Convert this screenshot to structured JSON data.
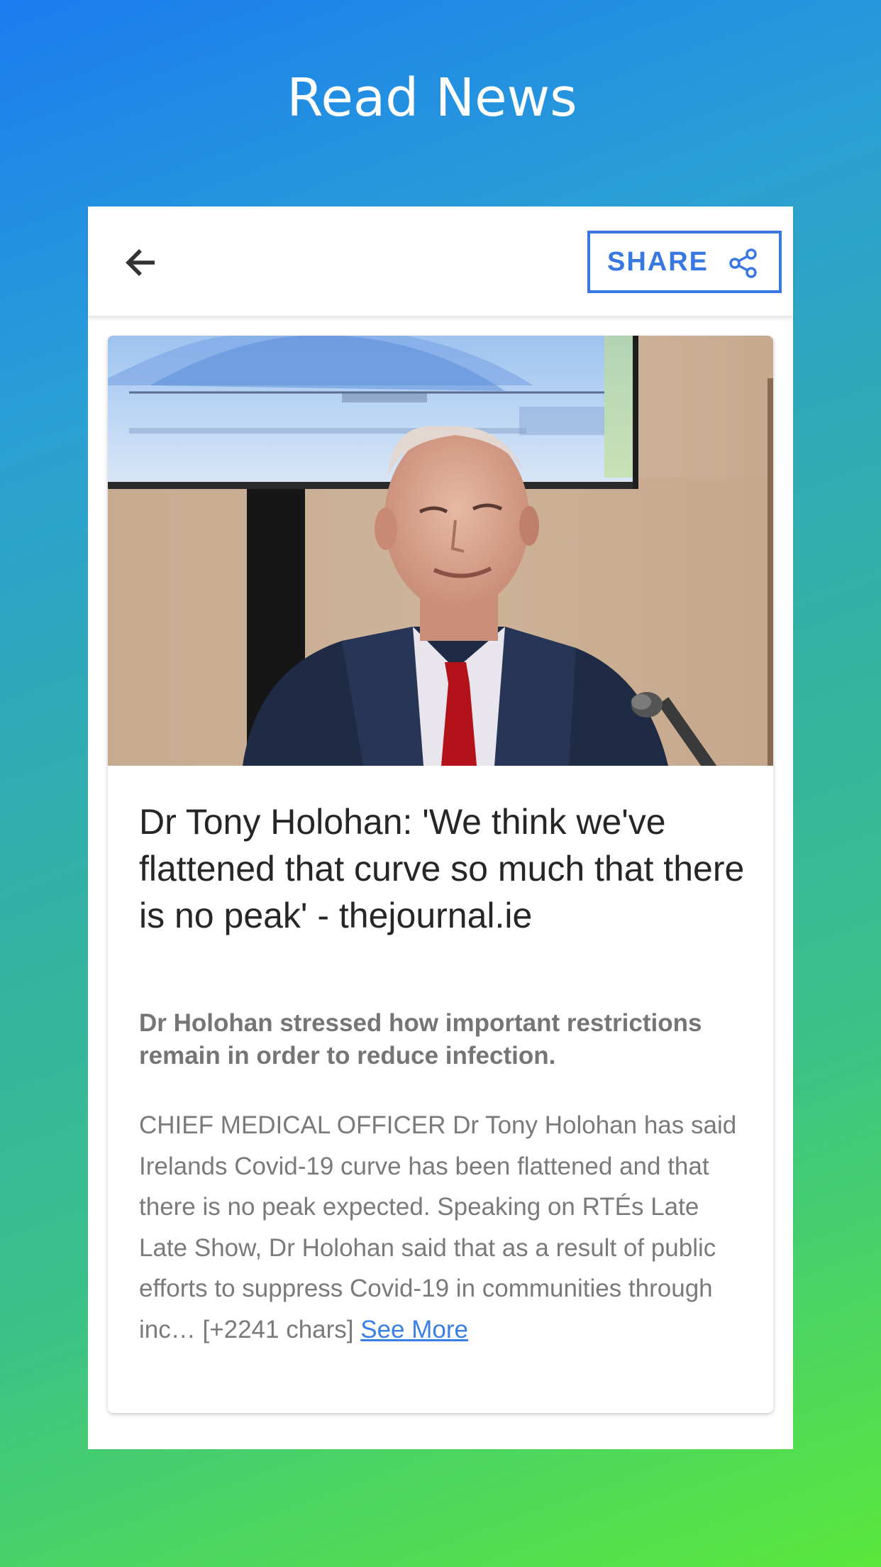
{
  "app": {
    "title": "Read News"
  },
  "toolbar": {
    "back_icon": "arrow-left-icon",
    "share_label": "SHARE",
    "share_icon": "share-nodes-icon"
  },
  "article": {
    "image_description_icon": "news-photo",
    "headline": "Dr Tony Holohan: 'We think we've flattened that curve so much that there is no peak' - thejournal.ie",
    "description": "Dr Holohan stressed how important restrictions remain in order to reduce infection.",
    "content": "CHIEF MEDICAL OFFICER Dr Tony Holohan has said Irelands Covid-19 curve has been flattened and that there is no peak expected.  Speaking on RTÉs Late Late Show, Dr Holohan said that as a result of public efforts to suppress Covid-19 in communities through inc… [+2241 chars] ",
    "see_more_label": "See More"
  },
  "colors": {
    "accent": "#3878e0",
    "link": "#3a7fe4",
    "gradient_top": "#1a7cf0",
    "gradient_bottom": "#5ae83c"
  }
}
